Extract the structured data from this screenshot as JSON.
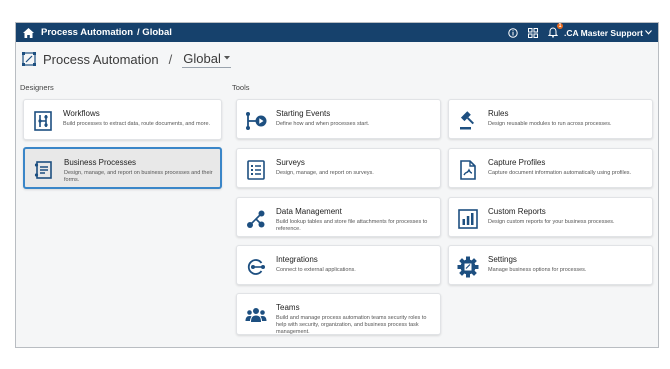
{
  "topbar": {
    "app_title": "Process Automation",
    "scope": "/ Global",
    "user": ".CA Master Support",
    "notification_count": "1"
  },
  "header": {
    "title": "Process Automation",
    "separator": "/",
    "scope": "Global"
  },
  "sections": {
    "designers": "Designers",
    "tools": "Tools"
  },
  "designers": [
    {
      "title": "Workflows",
      "desc": "Build processes to extract data, route documents, and more."
    },
    {
      "title": "Business Processes",
      "desc": "Design, manage, and report on business processes and their forms."
    }
  ],
  "tools": [
    {
      "title": "Starting Events",
      "desc": "Define how and when processes start."
    },
    {
      "title": "Rules",
      "desc": "Design reusable modules to run across processes."
    },
    {
      "title": "Surveys",
      "desc": "Design, manage, and report on surveys."
    },
    {
      "title": "Capture Profiles",
      "desc": "Capture document information automatically using profiles."
    },
    {
      "title": "Data Management",
      "desc": "Build lookup tables and store file attachments for processes to reference."
    },
    {
      "title": "Custom Reports",
      "desc": "Design custom reports for your business processes."
    },
    {
      "title": "Integrations",
      "desc": "Connect to external applications."
    },
    {
      "title": "Settings",
      "desc": "Manage business options for processes."
    },
    {
      "title": "Teams",
      "desc": "Build and manage process automation teams security roles to help with security, organization, and business process task management."
    }
  ],
  "colors": {
    "topbar": "#16416c",
    "icon": "#1d4f80",
    "selected_border": "#3a86c8"
  }
}
